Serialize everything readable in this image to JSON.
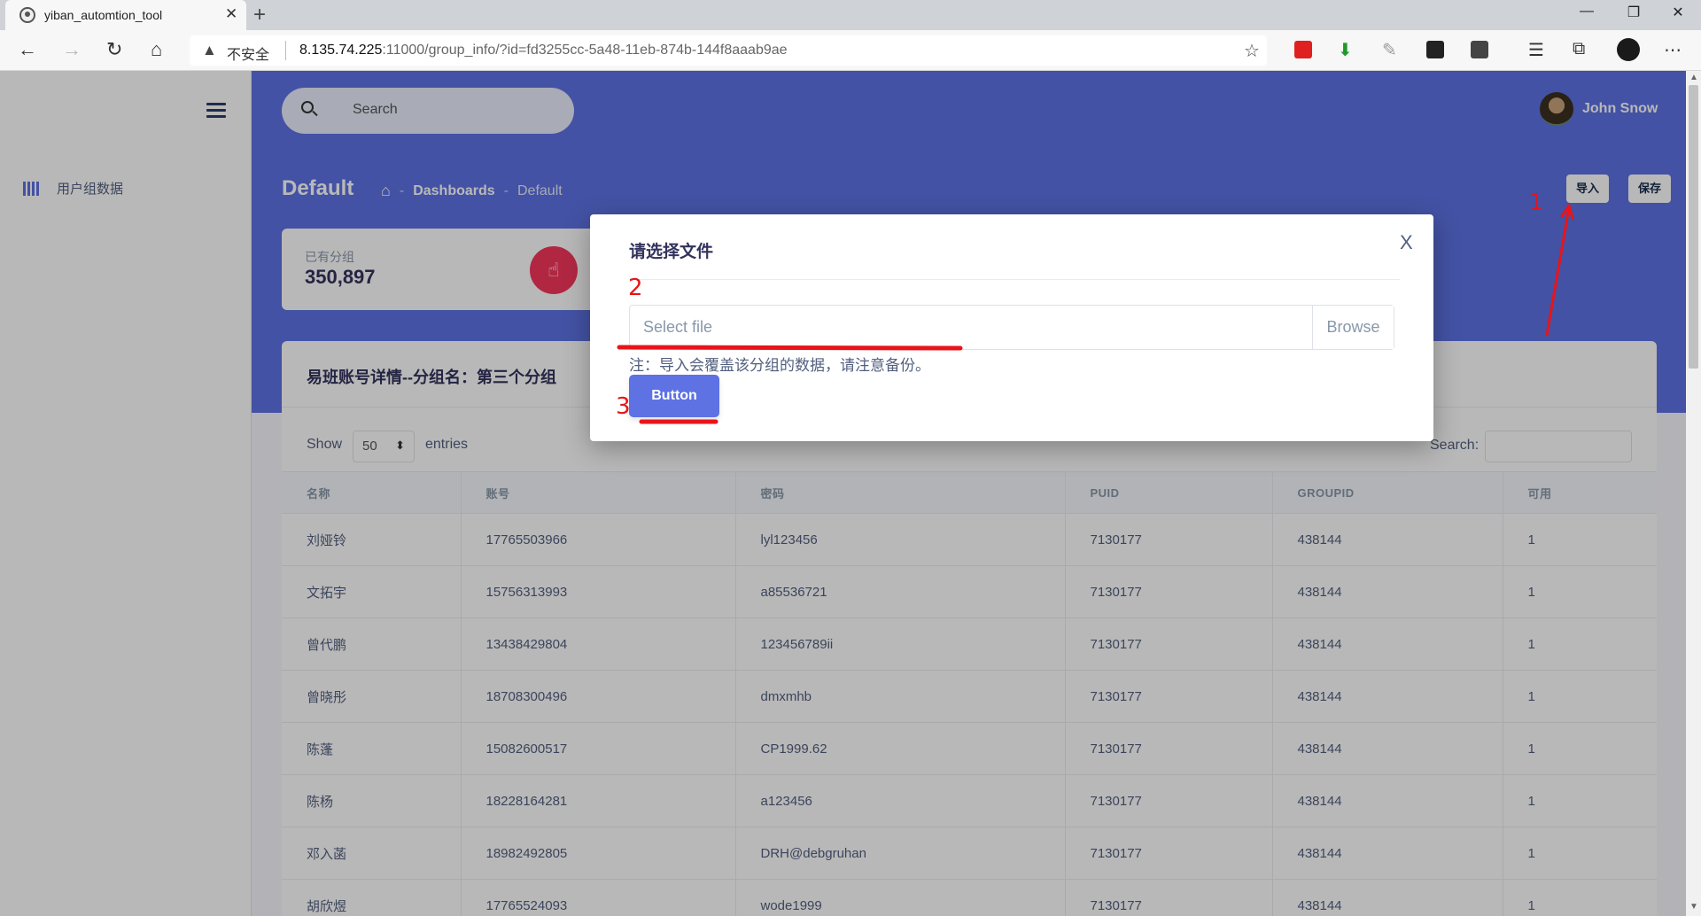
{
  "browser": {
    "tab_title": "yiban_automtion_tool",
    "tab_close": "✕",
    "new_tab": "+",
    "window_controls": [
      "—",
      "❐",
      "✕"
    ],
    "security_label": "不安全",
    "url_host": "8.135.74.225",
    "url_rest": ":11000/group_info/?id=fd3255cc-5a48-11eb-874b-144f8aaab9ae"
  },
  "sidebar": {
    "items": [
      {
        "label": "用户组数据",
        "icon": "bars-icon"
      }
    ]
  },
  "header": {
    "search_placeholder": "Search",
    "user_name": "John Snow",
    "page_title": "Default",
    "breadcrumbs": [
      "Dashboards",
      "Default"
    ],
    "import_label": "导入",
    "save_label": "保存"
  },
  "stat": {
    "label": "已有分组",
    "value": "350,897",
    "icon": "pointer-hand-icon",
    "icon_color": "#f5365c"
  },
  "table": {
    "title": "易班账号详情--分组名：第三个分组",
    "show_label": "Show",
    "page_size": "50",
    "entries_label": "entries",
    "search_label": "Search:",
    "columns": [
      "名称",
      "账号",
      "密码",
      "PUID",
      "GROUPID",
      "可用"
    ],
    "rows": [
      [
        "刘娅铃",
        "17765503966",
        "lyl123456",
        "7130177",
        "438144",
        "1"
      ],
      [
        "文拓宇",
        "15756313993",
        "a85536721",
        "7130177",
        "438144",
        "1"
      ],
      [
        "曾代鹏",
        "13438429804",
        "123456789ii",
        "7130177",
        "438144",
        "1"
      ],
      [
        "曾晓彤",
        "18708300496",
        "dmxmhb",
        "7130177",
        "438144",
        "1"
      ],
      [
        "陈蓬",
        "15082600517",
        "CP1999.62",
        "7130177",
        "438144",
        "1"
      ],
      [
        "陈杨",
        "18228164281",
        "a123456",
        "7130177",
        "438144",
        "1"
      ],
      [
        "邓入菡",
        "18982492805",
        "DRH@debgruhan",
        "7130177",
        "438144",
        "1"
      ],
      [
        "胡欣煜",
        "17765524093",
        "wode1999",
        "7130177",
        "438144",
        "1"
      ]
    ]
  },
  "modal": {
    "title": "请选择文件",
    "close_label": "X",
    "file_placeholder": "Select file",
    "browse_label": "Browse",
    "note": "注：导入会覆盖该分组的数据，请注意备份。",
    "button_label": "Button"
  },
  "annotations": {
    "step1": "1",
    "step2": "2",
    "step3": "3",
    "color": "#e8141a"
  },
  "colors": {
    "primary": "#5e72e4",
    "danger": "#f5365c"
  }
}
